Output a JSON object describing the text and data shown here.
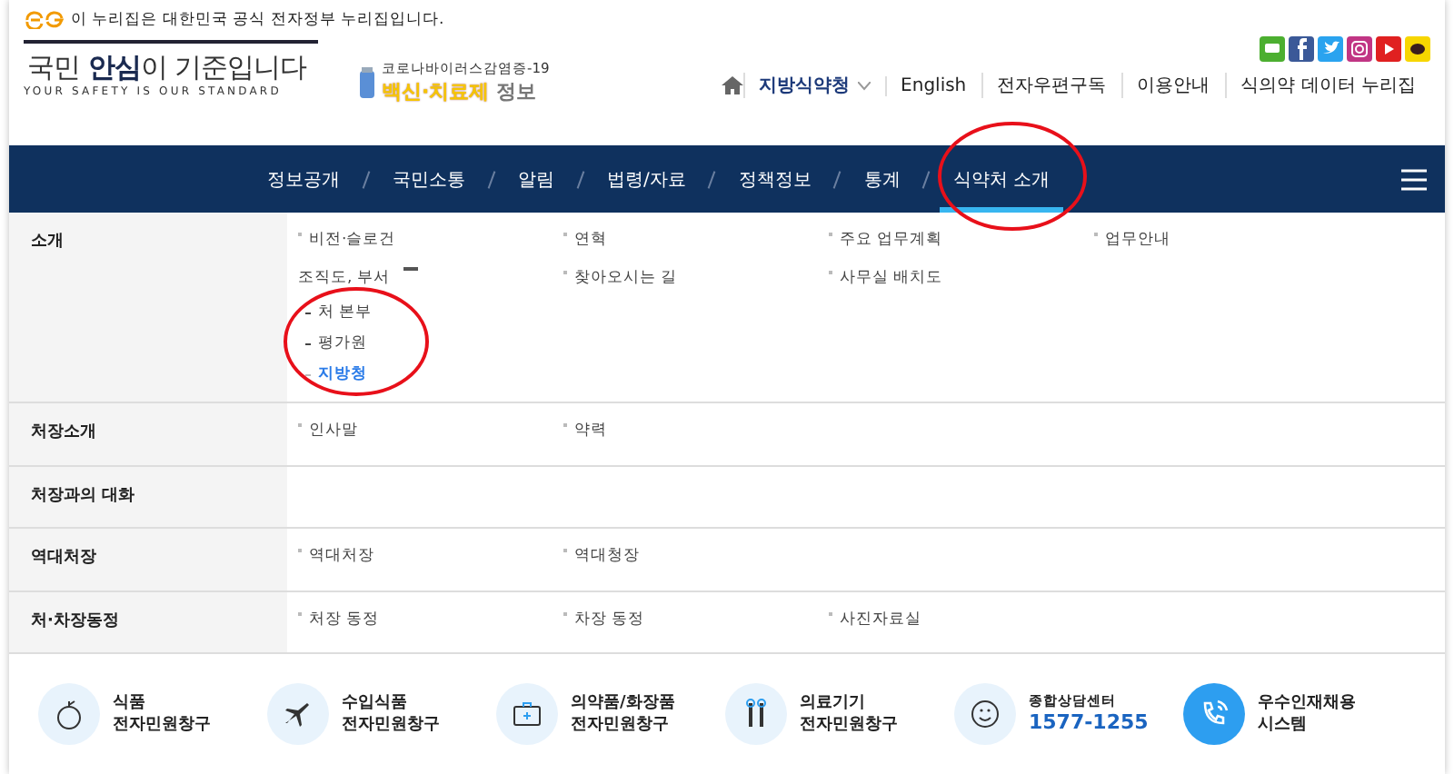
{
  "gov_notice": "이 누리집은 대한민국 공식 전자정부 누리집입니다.",
  "logo": {
    "title_parts": [
      "국민 ",
      "안심",
      "이 기준입니다"
    ],
    "subtitle": "YOUR SAFETY IS OUR STANDARD"
  },
  "banner": {
    "line1": "코로나바이러스감염증-19",
    "highlight": "백신·치료제",
    "rest": "정보"
  },
  "util_links": [
    {
      "label": "지방식약청",
      "kind": "dropdown"
    },
    {
      "label": "English",
      "kind": "link"
    },
    {
      "label": "전자우편구독",
      "kind": "link"
    },
    {
      "label": "이용안내",
      "kind": "link"
    },
    {
      "label": "식의약 데이터 누리집",
      "kind": "link"
    }
  ],
  "nav": [
    {
      "label": "정보공개",
      "selected": false
    },
    {
      "label": "국민소통",
      "selected": false
    },
    {
      "label": "알림",
      "selected": false
    },
    {
      "label": "법령/자료",
      "selected": false
    },
    {
      "label": "정책정보",
      "selected": false
    },
    {
      "label": "통계",
      "selected": false
    },
    {
      "label": "식약처 소개",
      "selected": true
    }
  ],
  "menu": [
    {
      "title": "소개",
      "items": [
        {
          "label": "비전·슬로건"
        },
        {
          "label": "연혁"
        },
        {
          "label": "주요 업무계획"
        },
        {
          "label": "업무안내"
        },
        {
          "label": "조직도, 부서",
          "expanded": true,
          "children": [
            {
              "label": "처 본부",
              "selected": false
            },
            {
              "label": "평가원",
              "selected": false
            },
            {
              "label": "지방청",
              "selected": true
            }
          ]
        },
        {
          "label": "찾아오시는 길"
        },
        {
          "label": "사무실 배치도"
        }
      ]
    },
    {
      "title": "처장소개",
      "items": [
        {
          "label": "인사말"
        },
        {
          "label": "약력"
        }
      ]
    },
    {
      "title": "처장과의 대화"
    },
    {
      "title": "역대처장",
      "items": [
        {
          "label": "역대처장"
        },
        {
          "label": "역대청장"
        }
      ]
    },
    {
      "title": "처·차장동정",
      "items": [
        {
          "label": "처장 동정"
        },
        {
          "label": "차장 동정"
        },
        {
          "label": "사진자료실"
        }
      ]
    }
  ],
  "services": [
    {
      "lines": [
        "식품",
        "전자민원창구"
      ],
      "kind": "plain",
      "highlighted": false
    },
    {
      "lines": [
        "수입식품",
        "전자민원창구"
      ],
      "kind": "plain",
      "highlighted": false
    },
    {
      "lines": [
        "의약품/화장품",
        "전자민원창구"
      ],
      "kind": "plain",
      "highlighted": false
    },
    {
      "lines": [
        "의료기기",
        "전자민원창구"
      ],
      "kind": "plain",
      "highlighted": false
    },
    {
      "lines": [
        "종합상담센터",
        "1577-1255"
      ],
      "kind": "hotline",
      "highlighted": false
    },
    {
      "lines": [
        "우수인재채용",
        "시스템"
      ],
      "kind": "plain",
      "highlighted": true
    }
  ]
}
